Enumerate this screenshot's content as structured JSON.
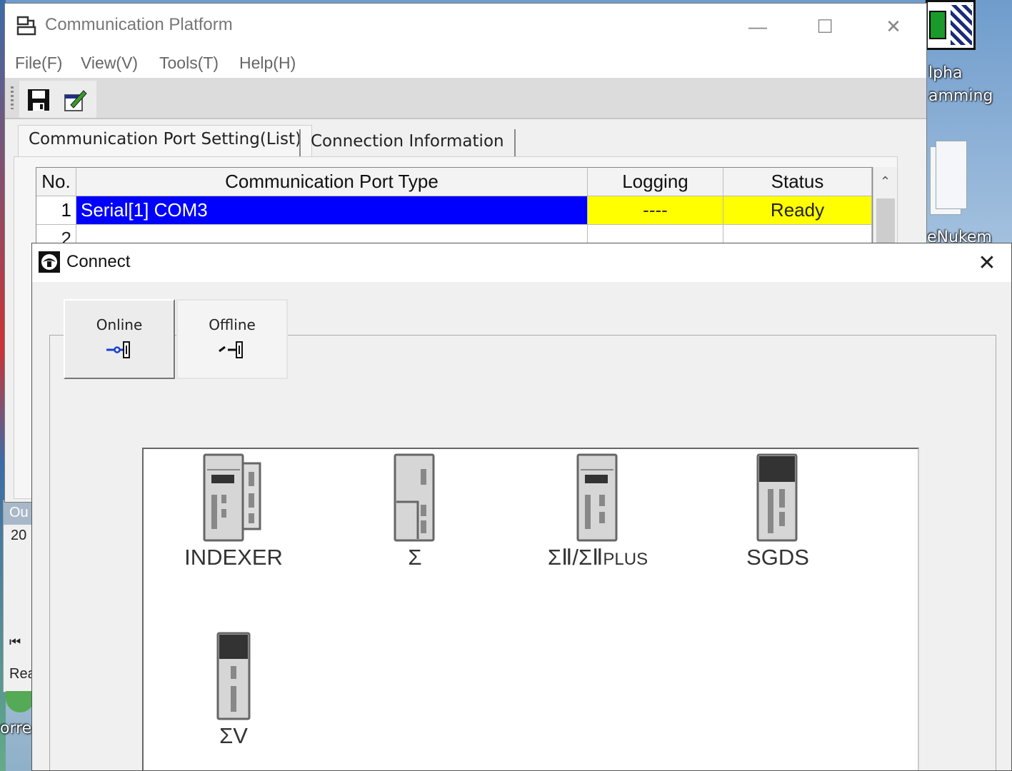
{
  "desktop": {
    "icon_labels": [
      "lpha",
      "amming",
      "eNukem",
      "orre"
    ]
  },
  "output_window": {
    "header": "Ou",
    "row": "20",
    "status": "Rea"
  },
  "comm_window": {
    "title": "Communication Platform",
    "menu": [
      "File(F)",
      "View(V)",
      "Tools(T)",
      "Help(H)"
    ],
    "toolbar": [
      "save-icon",
      "edit-icon"
    ],
    "tabs": [
      "Communication Port Setting(List)",
      "Connection Information"
    ],
    "grid": {
      "columns": [
        "No.",
        "Communication Port Type",
        "Logging",
        "Status"
      ],
      "rows": [
        {
          "no": "1",
          "type": "Serial[1] COM3",
          "logging": "----",
          "status": "Ready"
        },
        {
          "no": "2",
          "type": "",
          "logging": "",
          "status": ""
        }
      ]
    }
  },
  "connect_dialog": {
    "title": "Connect",
    "modes": [
      {
        "label": "Online",
        "icon": "online-plug-icon"
      },
      {
        "label": "Offline",
        "icon": "offline-plug-icon"
      }
    ],
    "devices": [
      {
        "label": "INDEXER",
        "icon": "indexer-drive-icon"
      },
      {
        "label": "Σ",
        "icon": "sigma-drive-icon"
      },
      {
        "label": "ΣⅡ/ΣⅡ",
        "suffix": "PLUS",
        "icon": "sigma2-drive-icon"
      },
      {
        "label": "SGDS",
        "icon": "sgds-drive-icon"
      },
      {
        "label": "ΣV",
        "icon": "sigma5-drive-icon"
      }
    ]
  },
  "colors": {
    "selection": "#0000ff",
    "highlight": "#ffff00",
    "online_icon": "#1a3fd0"
  }
}
